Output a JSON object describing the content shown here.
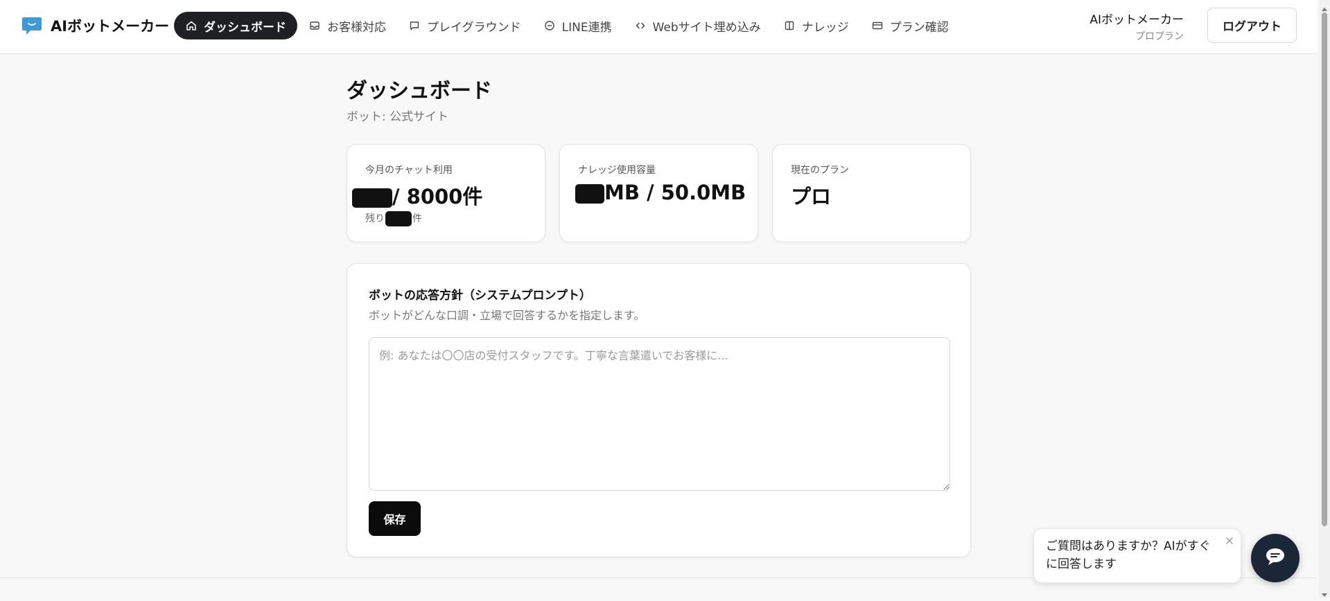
{
  "brand": {
    "name": "AIボットメーカー",
    "logo_color": "#3a9bd8"
  },
  "nav": {
    "items": [
      {
        "label": "ダッシュボード",
        "icon": "home-icon",
        "active": true
      },
      {
        "label": "お客様対応",
        "icon": "inbox-icon",
        "active": false
      },
      {
        "label": "プレイグラウンド",
        "icon": "chat-bubble-icon",
        "active": false
      },
      {
        "label": "LINE連携",
        "icon": "line-circle-icon",
        "active": false
      },
      {
        "label": "Webサイト埋め込み",
        "icon": "code-icon",
        "active": false
      },
      {
        "label": "ナレッジ",
        "icon": "book-icon",
        "active": false
      },
      {
        "label": "プラン確認",
        "icon": "credit-card-icon",
        "active": false
      }
    ]
  },
  "user": {
    "name": "AIボットメーカー",
    "plan": "プロプラン",
    "logout_label": "ログアウト"
  },
  "page": {
    "title": "ダッシュボード",
    "subtitle": "ボット: 公式サイト"
  },
  "stats": {
    "chat": {
      "label": "今月のチャット利用",
      "value_suffix": "/ 8000件",
      "remaining_prefix": "残り",
      "remaining_suffix": "件"
    },
    "knowledge": {
      "label": "ナレッジ使用容量",
      "value_suffix": "MB / 50.0MB"
    },
    "plan": {
      "label": "現在のプラン",
      "value": "プロ"
    }
  },
  "prompt": {
    "title": "ボットの応答方針（システムプロンプト）",
    "description": "ボットがどんな口調・立場で回答するかを指定します。",
    "placeholder": "例: あなたは〇〇店の受付スタッフです。丁寧な言葉遣いでお客様に...",
    "value": "",
    "save_label": "保存"
  },
  "chat_widget": {
    "message": "ご質問はありますか？AIがすぐに回答します",
    "fab_color": "#1b2636"
  }
}
